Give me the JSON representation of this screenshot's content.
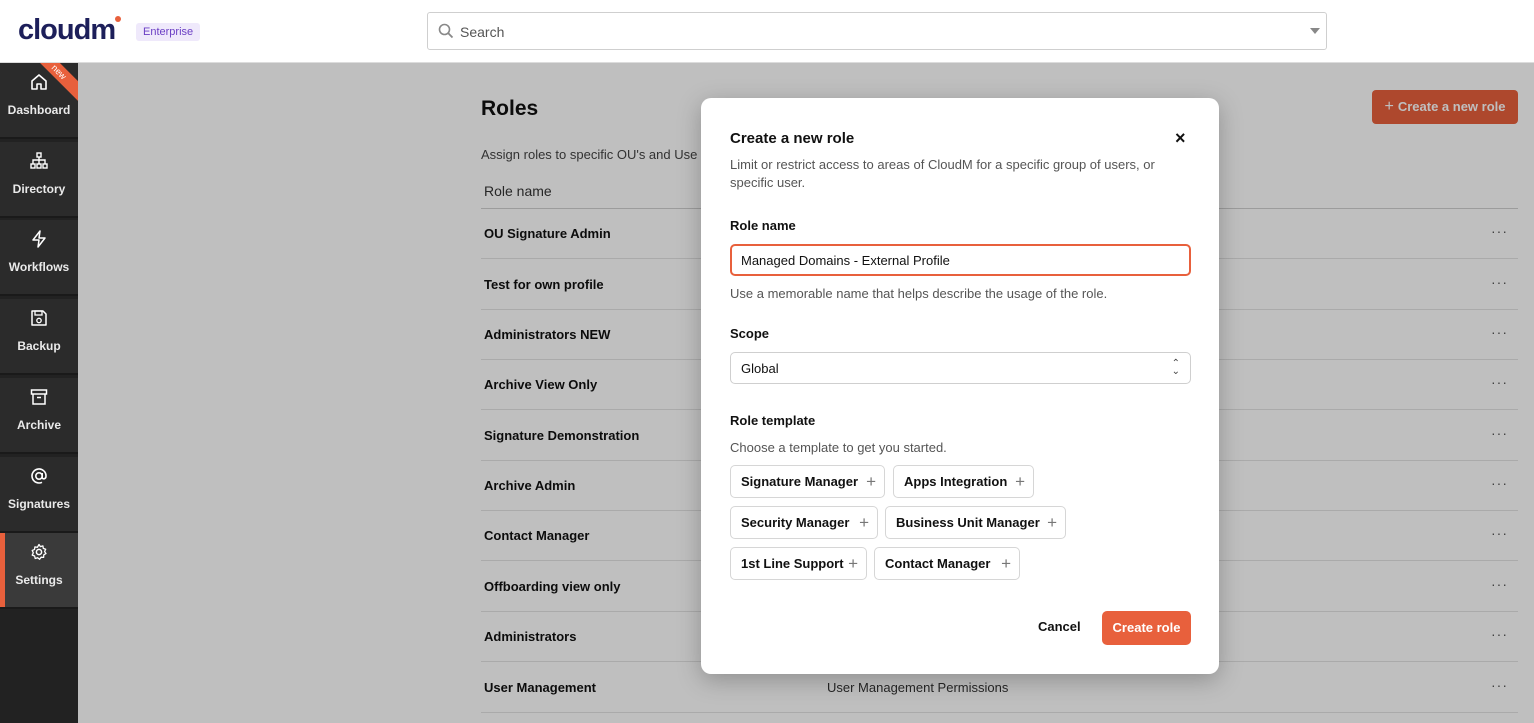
{
  "brand": {
    "logo": "cloudm",
    "edition": "Enterprise"
  },
  "search": {
    "placeholder": "Search"
  },
  "sidebar": {
    "badge": "new",
    "items": [
      {
        "label": "Dashboard",
        "icon": "home-icon"
      },
      {
        "label": "Directory",
        "icon": "org-chart-icon"
      },
      {
        "label": "Workflows",
        "icon": "lightning-icon"
      },
      {
        "label": "Backup",
        "icon": "floppy-icon"
      },
      {
        "label": "Archive",
        "icon": "archive-box-icon"
      },
      {
        "label": "Signatures",
        "icon": "at-sign-icon"
      },
      {
        "label": "Settings",
        "icon": "gear-icon",
        "active": true
      }
    ]
  },
  "page": {
    "title": "Roles",
    "subtitle": "Assign roles to specific OU's and Use",
    "create_button": "Create a new role",
    "column_role_name": "Role name",
    "rows": [
      {
        "name": "OU Signature Admin",
        "desc": ""
      },
      {
        "name": "Test for own profile",
        "desc": ""
      },
      {
        "name": "Administrators NEW",
        "desc": ""
      },
      {
        "name": "Archive View Only",
        "desc": ""
      },
      {
        "name": "Signature Demonstration",
        "desc": ""
      },
      {
        "name": "Archive Admin",
        "desc": ""
      },
      {
        "name": "Contact Manager",
        "desc": ""
      },
      {
        "name": "Offboarding view only",
        "desc": ""
      },
      {
        "name": "Administrators",
        "desc": ""
      },
      {
        "name": "User Management",
        "desc": "User Management Permissions"
      }
    ],
    "more": "···"
  },
  "modal": {
    "title": "Create a new role",
    "close": "×",
    "description": "Limit or restrict access to areas of CloudM for a specific group of users, or specific user.",
    "role_name_label": "Role name",
    "role_name_value": "Managed Domains - External Profile",
    "role_name_hint": "Use a memorable name that helps describe the usage of the role.",
    "scope_label": "Scope",
    "scope_value": "Global",
    "template_label": "Role template",
    "template_hint": "Choose a template to get you started.",
    "templates": [
      "Signature Manager",
      "Apps Integration",
      "Security Manager",
      "Business Unit Manager",
      "1st Line Support",
      "Contact Manager"
    ],
    "cancel": "Cancel",
    "submit": "Create role"
  },
  "colors": {
    "accent": "#e8603c",
    "sidebar": "#2b2b2b"
  }
}
